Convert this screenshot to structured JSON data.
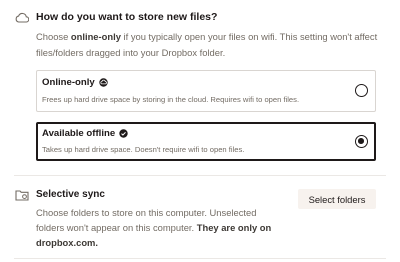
{
  "store": {
    "icon": "cloud-icon",
    "title": "How do you want to store new files?",
    "desc_prefix": "Choose ",
    "desc_bold": "online-only",
    "desc_suffix": " if you typically open your files on wifi. This setting won't affect files/folders dragged into your Dropbox folder."
  },
  "options": [
    {
      "title": "Online-only",
      "icon": "cloud-status-icon",
      "description": "Frees up hard drive space by storing in the cloud. Requires wifi to open files.",
      "selected": false
    },
    {
      "title": "Available offline",
      "icon": "check-circle-icon",
      "description": "Takes up hard drive space. Doesn't require wifi to open files.",
      "selected": true
    }
  ],
  "selective_sync": {
    "icon": "folder-sync-icon",
    "title": "Selective sync",
    "desc_prefix": "Choose folders to store on this computer. Unselected folders won't appear on this computer. ",
    "desc_bold": "They are only on dropbox.com.",
    "button_label": "Select folders"
  },
  "colors": {
    "text": "#1e1919",
    "muted": "#736c64",
    "selected_border": "#1e1919",
    "button_bg": "#f7f2ee"
  }
}
